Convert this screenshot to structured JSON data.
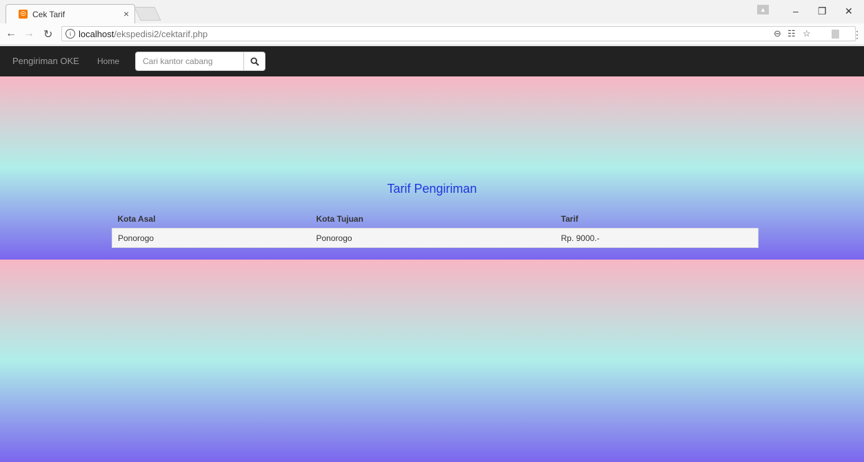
{
  "browser": {
    "tab": {
      "title": "Cek Tarif",
      "favicon": "xampp-icon",
      "close": "×"
    },
    "url_host": "localhost",
    "url_path": "/ekspedisi2/cektarif.php"
  },
  "navbar": {
    "brand": "Pengiriman OKE",
    "home": "Home",
    "search_placeholder": "Cari kantor cabang"
  },
  "main": {
    "title": "Tarif Pengiriman",
    "columns": [
      "Kota Asal",
      "Kota Tujuan",
      "Tarif"
    ],
    "rows": [
      [
        "Ponorogo",
        "Ponorogo",
        "Rp. 9000.-"
      ]
    ]
  },
  "colors": {
    "navbar_bg": "#222222",
    "heading": "#1f35e0",
    "gradient_top": "#f7b6c4",
    "gradient_mid": "#afeee9",
    "gradient_bottom": "#7b66ee"
  }
}
